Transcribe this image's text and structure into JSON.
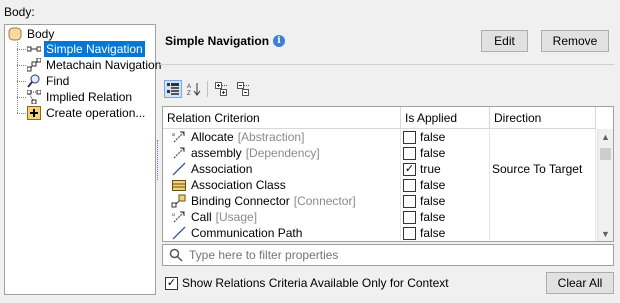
{
  "body_label": "Body:",
  "tree": {
    "root": "Body",
    "items": [
      {
        "label": "Simple Navigation",
        "icon": "simple-navigation-icon",
        "selected": true
      },
      {
        "label": "Metachain Navigation",
        "icon": "metachain-navigation-icon",
        "selected": false
      },
      {
        "label": "Find",
        "icon": "find-icon",
        "selected": false
      },
      {
        "label": "Implied Relation",
        "icon": "implied-relation-icon",
        "selected": false
      },
      {
        "label": "Create operation...",
        "icon": "create-operation-icon",
        "selected": false
      }
    ]
  },
  "panel": {
    "title": "Simple Navigation",
    "info_glyph": "i",
    "edit_label": "Edit",
    "remove_label": "Remove"
  },
  "grid": {
    "columns": [
      "Relation Criterion",
      "Is Applied",
      "Direction"
    ],
    "rows": [
      {
        "name": "Allocate",
        "stereotype": "[Abstraction]",
        "applied": false,
        "applied_text": "false",
        "direction": "",
        "icon": "allocate-icon"
      },
      {
        "name": "assembly",
        "stereotype": "[Dependency]",
        "applied": false,
        "applied_text": "false",
        "direction": "",
        "icon": "dependency-icon"
      },
      {
        "name": "Association",
        "stereotype": "",
        "applied": true,
        "applied_text": "true",
        "direction": "Source To Target",
        "icon": "association-icon"
      },
      {
        "name": "Association Class",
        "stereotype": "",
        "applied": false,
        "applied_text": "false",
        "direction": "",
        "icon": "association-class-icon"
      },
      {
        "name": "Binding Connector",
        "stereotype": "[Connector]",
        "applied": false,
        "applied_text": "false",
        "direction": "",
        "icon": "binding-connector-icon"
      },
      {
        "name": "Call",
        "stereotype": "[Usage]",
        "applied": false,
        "applied_text": "false",
        "direction": "",
        "icon": "usage-icon"
      },
      {
        "name": "Communication Path",
        "stereotype": "",
        "applied": false,
        "applied_text": "false",
        "direction": "",
        "icon": "communication-path-icon"
      }
    ]
  },
  "filter": {
    "placeholder": "Type here to filter properties"
  },
  "show_relations": {
    "label": "Show Relations Criteria Available Only for Context",
    "checked": true
  },
  "clear_all_label": "Clear All",
  "colors": {
    "selection": "#0078d7",
    "info": "#3b7fd6"
  }
}
